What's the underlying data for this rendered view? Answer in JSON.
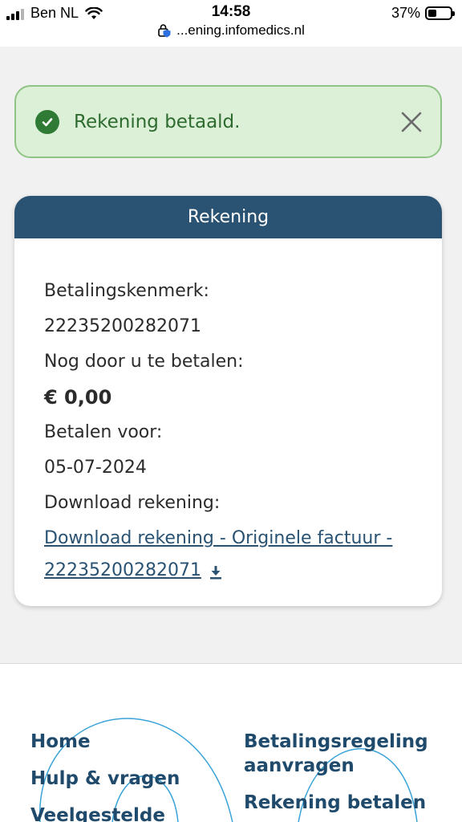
{
  "status_bar": {
    "carrier": "Ben NL",
    "time": "14:58",
    "battery": "37%",
    "battery_level": 0.37,
    "url": "...ening.infomedics.nl"
  },
  "alert": {
    "message": "Rekening betaald.",
    "icon": "check-circle-icon",
    "close_icon": "close-icon",
    "colors": {
      "background": "#dcefd7",
      "border": "#8fc486",
      "text": "#2e6b2f"
    }
  },
  "card": {
    "title": "Rekening",
    "header_color": "#2a5272",
    "payment_reference_label": "Betalingskenmerk:",
    "payment_reference_value": "22235200282071",
    "amount_due_label": "Nog door u te betalen:",
    "amount_due_value": "€ 0,00",
    "pay_before_label": "Betalen voor:",
    "pay_before_value": "05-07-2024",
    "download_label": "Download rekening:",
    "download_link_line1": "Download rekening - Originele factuur -",
    "download_link_line2": "22235200282071",
    "download_icon": "download-icon"
  },
  "footer": {
    "nav_left": [
      "Home",
      "Hulp & vragen",
      "Veelgestelde"
    ],
    "nav_right": [
      "Betalingsregeling",
      "aanvragen",
      "Rekening betalen"
    ],
    "nav_color": "#1f4a6b",
    "decor_color": "#3aa3d9"
  }
}
